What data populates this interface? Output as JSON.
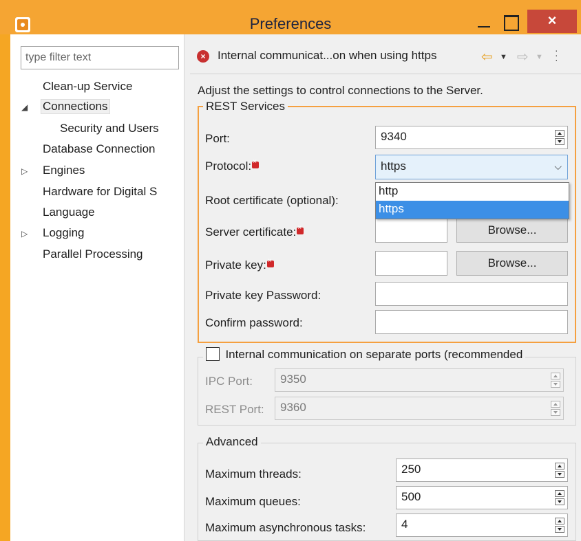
{
  "window": {
    "title": "Preferences",
    "minimize_icon": "minimize-icon",
    "maximize_icon": "maximize-icon",
    "close_label": "×"
  },
  "sidebar": {
    "filter_placeholder": "type filter text",
    "items": [
      {
        "label": "Clean-up Service"
      },
      {
        "label": "Connections",
        "expanded": true,
        "selected": true
      },
      {
        "label": "Security and Users"
      },
      {
        "label": "Database Connection"
      },
      {
        "label": "Engines",
        "collapsed": true
      },
      {
        "label": "Hardware for Digital S"
      },
      {
        "label": "Language"
      },
      {
        "label": "Logging",
        "collapsed": true
      },
      {
        "label": "Parallel Processing"
      }
    ]
  },
  "header": {
    "title": "Internal communicat...on when using https",
    "error_icon": "error-icon"
  },
  "description": "Adjust the settings to control connections to the Server.",
  "rest_services": {
    "legend": "REST Services",
    "port_label": "Port:",
    "port_value": "9340",
    "protocol_label": "Protocol:",
    "protocol_value": "https",
    "protocol_options": [
      "http",
      "https"
    ],
    "root_cert_label": "Root certificate (optional):",
    "server_cert_label": "Server certificate:",
    "private_key_label": "Private key:",
    "browse_label": "Browse...",
    "private_key_password_label": "Private key Password:",
    "confirm_password_label": "Confirm password:"
  },
  "internal": {
    "checkbox_label": "Internal communication on separate ports (recommended",
    "checked": false,
    "ipc_port_label": "IPC Port:",
    "ipc_port_value": "9350",
    "rest_port_label": "REST Port:",
    "rest_port_value": "9360"
  },
  "advanced": {
    "legend": "Advanced",
    "max_threads_label": "Maximum threads:",
    "max_threads_value": "250",
    "max_queues_label": "Maximum queues:",
    "max_queues_value": "500",
    "max_async_label": "Maximum asynchronous tasks:",
    "max_async_value": "4"
  },
  "colors": {
    "titlebar": "#f5a533",
    "close_button": "#c7483a",
    "focus_border": "#f5a040",
    "selection": "#3c8fe6"
  }
}
